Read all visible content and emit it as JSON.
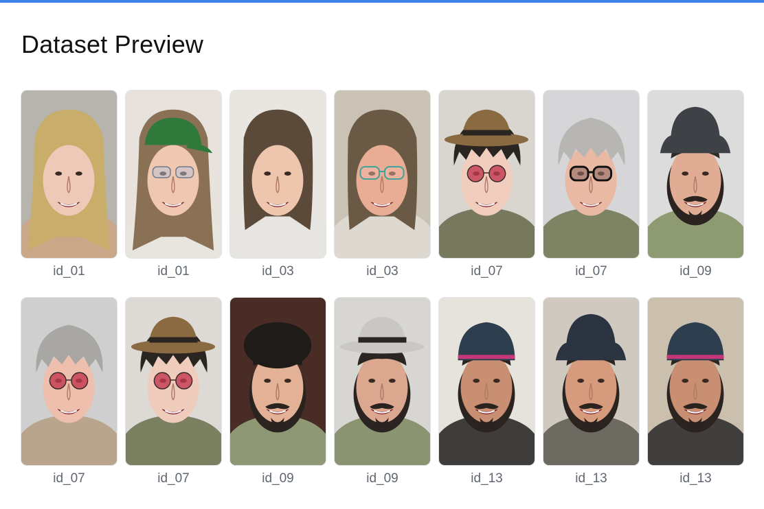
{
  "page": {
    "title": "Dataset Preview"
  },
  "gallery": {
    "items": [
      {
        "label": "id_01",
        "bg": "#b7b3ad",
        "skin": "#efc9b8",
        "hair": "#c9ad6a",
        "hair_style": "long",
        "hat": "none",
        "hat_color": "",
        "glasses": "none",
        "shirt": "#c9a789",
        "beard": false
      },
      {
        "label": "id_01",
        "bg": "#e7e3dc",
        "skin": "#f0c7b0",
        "hair": "#8a7156",
        "hair_style": "long",
        "hat": "cap",
        "hat_color": "#2f7a3a",
        "glasses": "clear",
        "shirt": "#e8e5df",
        "beard": false
      },
      {
        "label": "id_03",
        "bg": "#e9e6e1",
        "skin": "#edc6ad",
        "hair": "#5b4a3a",
        "hair_style": "bob",
        "hat": "none",
        "hat_color": "",
        "glasses": "none",
        "shirt": "#e6e5e2",
        "beard": false
      },
      {
        "label": "id_03",
        "bg": "#c9c2b5",
        "skin": "#e9ad96",
        "hair": "#6a5a45",
        "hair_style": "bob",
        "hat": "none",
        "hat_color": "",
        "glasses": "teal",
        "shirt": "#ded9d0",
        "beard": false
      },
      {
        "label": "id_07",
        "bg": "#d9d6d0",
        "skin": "#f1cdbd",
        "hair": "#2a2521",
        "hair_style": "shaggy",
        "hat": "fedora",
        "hat_color": "#8a6a40",
        "glasses": "round-red",
        "shirt": "#77795e",
        "beard": false
      },
      {
        "label": "id_07",
        "bg": "#d6d5d8",
        "skin": "#eab9a4",
        "hair": "#b8b6b2",
        "hair_style": "shaggy",
        "hat": "none",
        "hat_color": "",
        "glasses": "dark",
        "shirt": "#7e8463",
        "beard": false
      },
      {
        "label": "id_09",
        "bg": "#dcdcdc",
        "skin": "#e0ad94",
        "hair": "#2e2a26",
        "hair_style": "short",
        "hat": "bucket",
        "hat_color": "#3e4247",
        "glasses": "none",
        "shirt": "#8d9a72",
        "beard": true
      },
      {
        "label": "id_07",
        "bg": "#cfcfcf",
        "skin": "#eebfad",
        "hair": "#a9a7a3",
        "hair_style": "shaggy",
        "hat": "none",
        "hat_color": "",
        "glasses": "round-red",
        "shirt": "#b9a48d",
        "beard": false
      },
      {
        "label": "id_07",
        "bg": "#ddd9d4",
        "skin": "#f0ccbd",
        "hair": "#2a2521",
        "hair_style": "shaggy",
        "hat": "fedora",
        "hat_color": "#8a6a40",
        "glasses": "round-red",
        "shirt": "#7b8061",
        "beard": false
      },
      {
        "label": "id_09",
        "bg": "#4a2c26",
        "skin": "#e2b196",
        "hair": "#1e1b19",
        "hair_style": "poof",
        "hat": "none",
        "hat_color": "",
        "glasses": "none",
        "shirt": "#8f9874",
        "beard": true
      },
      {
        "label": "id_09",
        "bg": "#d8d6d2",
        "skin": "#dba78f",
        "hair": "#2a2521",
        "hair_style": "short",
        "hat": "fedora",
        "hat_color": "#c9c8c5",
        "glasses": "none",
        "shirt": "#8a9470",
        "beard": true
      },
      {
        "label": "id_13",
        "bg": "#e6e2dc",
        "skin": "#c98f72",
        "hair": "#2a2521",
        "hair_style": "short",
        "hat": "beanie",
        "hat_color": "#2d3e4e",
        "glasses": "none",
        "shirt": "#3e3d3c",
        "beard": true
      },
      {
        "label": "id_13",
        "bg": "#cfc9bf",
        "skin": "#d69b7c",
        "hair": "#2a2521",
        "hair_style": "short",
        "hat": "bucket",
        "hat_color": "#2b3440",
        "glasses": "none",
        "shirt": "#6d6b61",
        "beard": true
      },
      {
        "label": "id_13",
        "bg": "#cbbfae",
        "skin": "#c98f72",
        "hair": "#2a2521",
        "hair_style": "short",
        "hat": "beanie",
        "hat_color": "#2d3e4e",
        "glasses": "none",
        "shirt": "#403f3d",
        "beard": true
      }
    ]
  }
}
